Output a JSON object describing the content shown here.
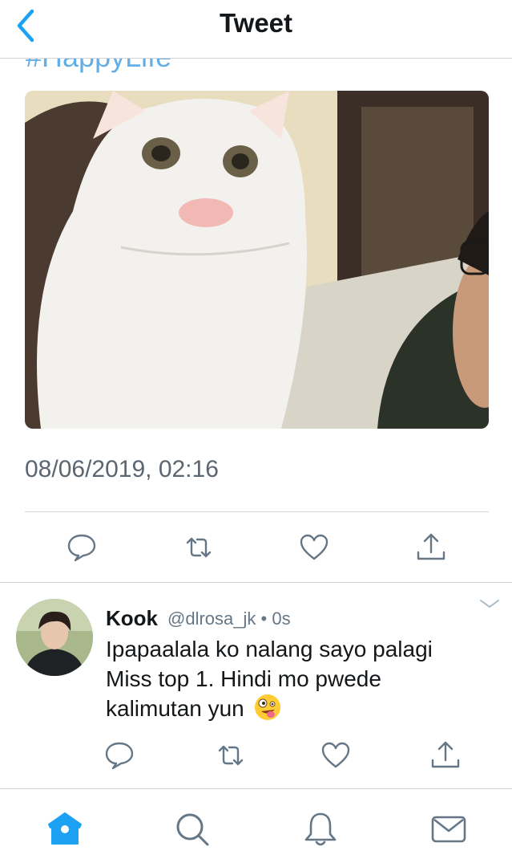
{
  "header": {
    "title": "Tweet"
  },
  "tweet": {
    "hashtag": "#HappyLife",
    "timestamp": "08/06/2019, 02:16"
  },
  "reply": {
    "name": "Kook",
    "handle": "@dlrosa_jk",
    "time": "0s",
    "text_lines": [
      "Ipapaalala ko nalang sayo palagi",
      "Miss top 1. Hindi mo pwede",
      "kalimutan yun"
    ],
    "emoji": "zany-face-emoji"
  },
  "tabbar": {
    "items": [
      "home-icon",
      "search-icon",
      "notifications-icon",
      "messages-icon"
    ],
    "active": "home-icon"
  },
  "colors": {
    "accent": "#1da1f2",
    "icon_gray": "#657786",
    "hashtag": "#62aee6"
  }
}
